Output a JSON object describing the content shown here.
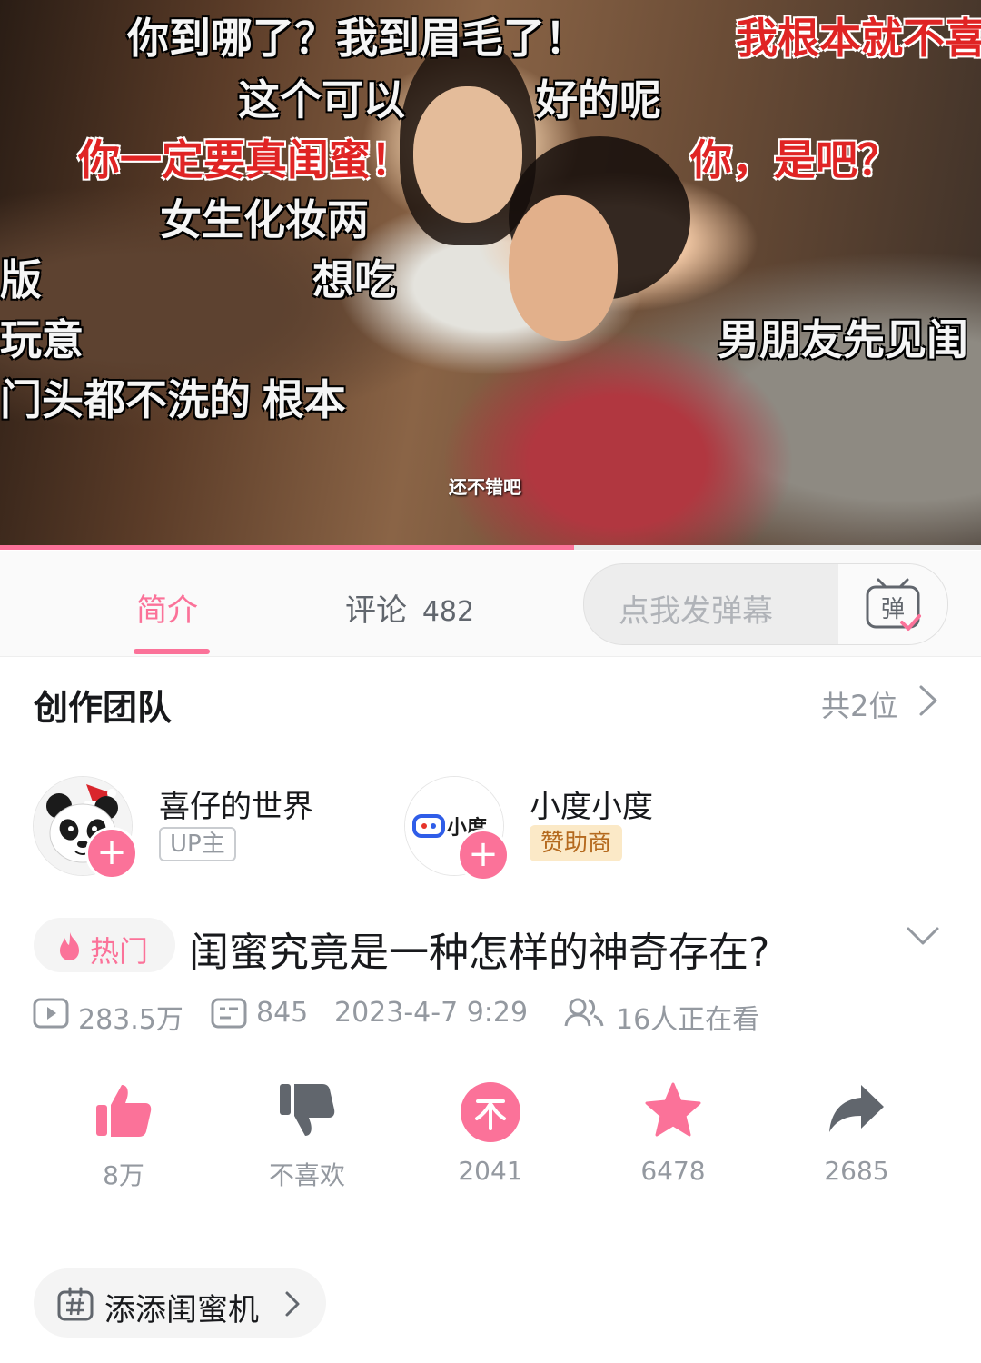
{
  "video": {
    "danmaku": [
      {
        "text": "你到哪了？我到眉毛了！",
        "red": false
      },
      {
        "text": "我根本就不喜",
        "red": true
      },
      {
        "text": "这个可以",
        "red": false
      },
      {
        "text": "好的呢",
        "red": false
      },
      {
        "text": "你一定要真闺蜜！",
        "red": true
      },
      {
        "text": "你，是吧？",
        "red": true
      },
      {
        "text": "女生化妆两",
        "red": false
      },
      {
        "text": "版",
        "red": false
      },
      {
        "text": "想吃",
        "red": false
      },
      {
        "text": "玩意",
        "red": false
      },
      {
        "text": "男朋友先见闺",
        "red": false
      },
      {
        "text": "门头都不洗的 根本",
        "red": false
      }
    ],
    "subtitle": "还不错吧",
    "progress": 0.585
  },
  "tabs": {
    "intro": "简介",
    "comments": "评论",
    "comments_count": "482",
    "danmaku_placeholder": "点我发弹幕",
    "danmaku_icon_char": "弹"
  },
  "team": {
    "title": "创作团队",
    "count": "共2位",
    "members": [
      {
        "name": "喜仔的世界",
        "role": "UP主"
      },
      {
        "name": "小度小度",
        "role": "赞助商",
        "logo_text": "小度"
      }
    ]
  },
  "video_info": {
    "hot_label": "热门",
    "title": "闺蜜究竟是一种怎样的神奇存在?",
    "views": "283.5万",
    "danmaku_count": "845",
    "date": "2023-4-7 9:29",
    "watching": "16人正在看"
  },
  "actions": {
    "like": "8万",
    "dislike": "不喜欢",
    "coin": "2041",
    "favorite": "6478",
    "share": "2685"
  },
  "topic": {
    "label": "添添闺蜜机"
  },
  "colors": {
    "accent": "#fb7299",
    "text_primary": "#18191c",
    "text_secondary": "#9499a0",
    "sponsor_bg": "#fbe9c7",
    "share_icon": "#61666d"
  },
  "icons": [
    "play-icon",
    "danmaku-count-icon",
    "watching-icon",
    "like-icon",
    "dislike-icon",
    "coin-icon",
    "favorite-icon",
    "share-icon",
    "flame-icon",
    "topic-hash-icon",
    "chevron-right-icon",
    "chevron-down-icon",
    "plus-icon",
    "danmaku-toggle-icon"
  ]
}
